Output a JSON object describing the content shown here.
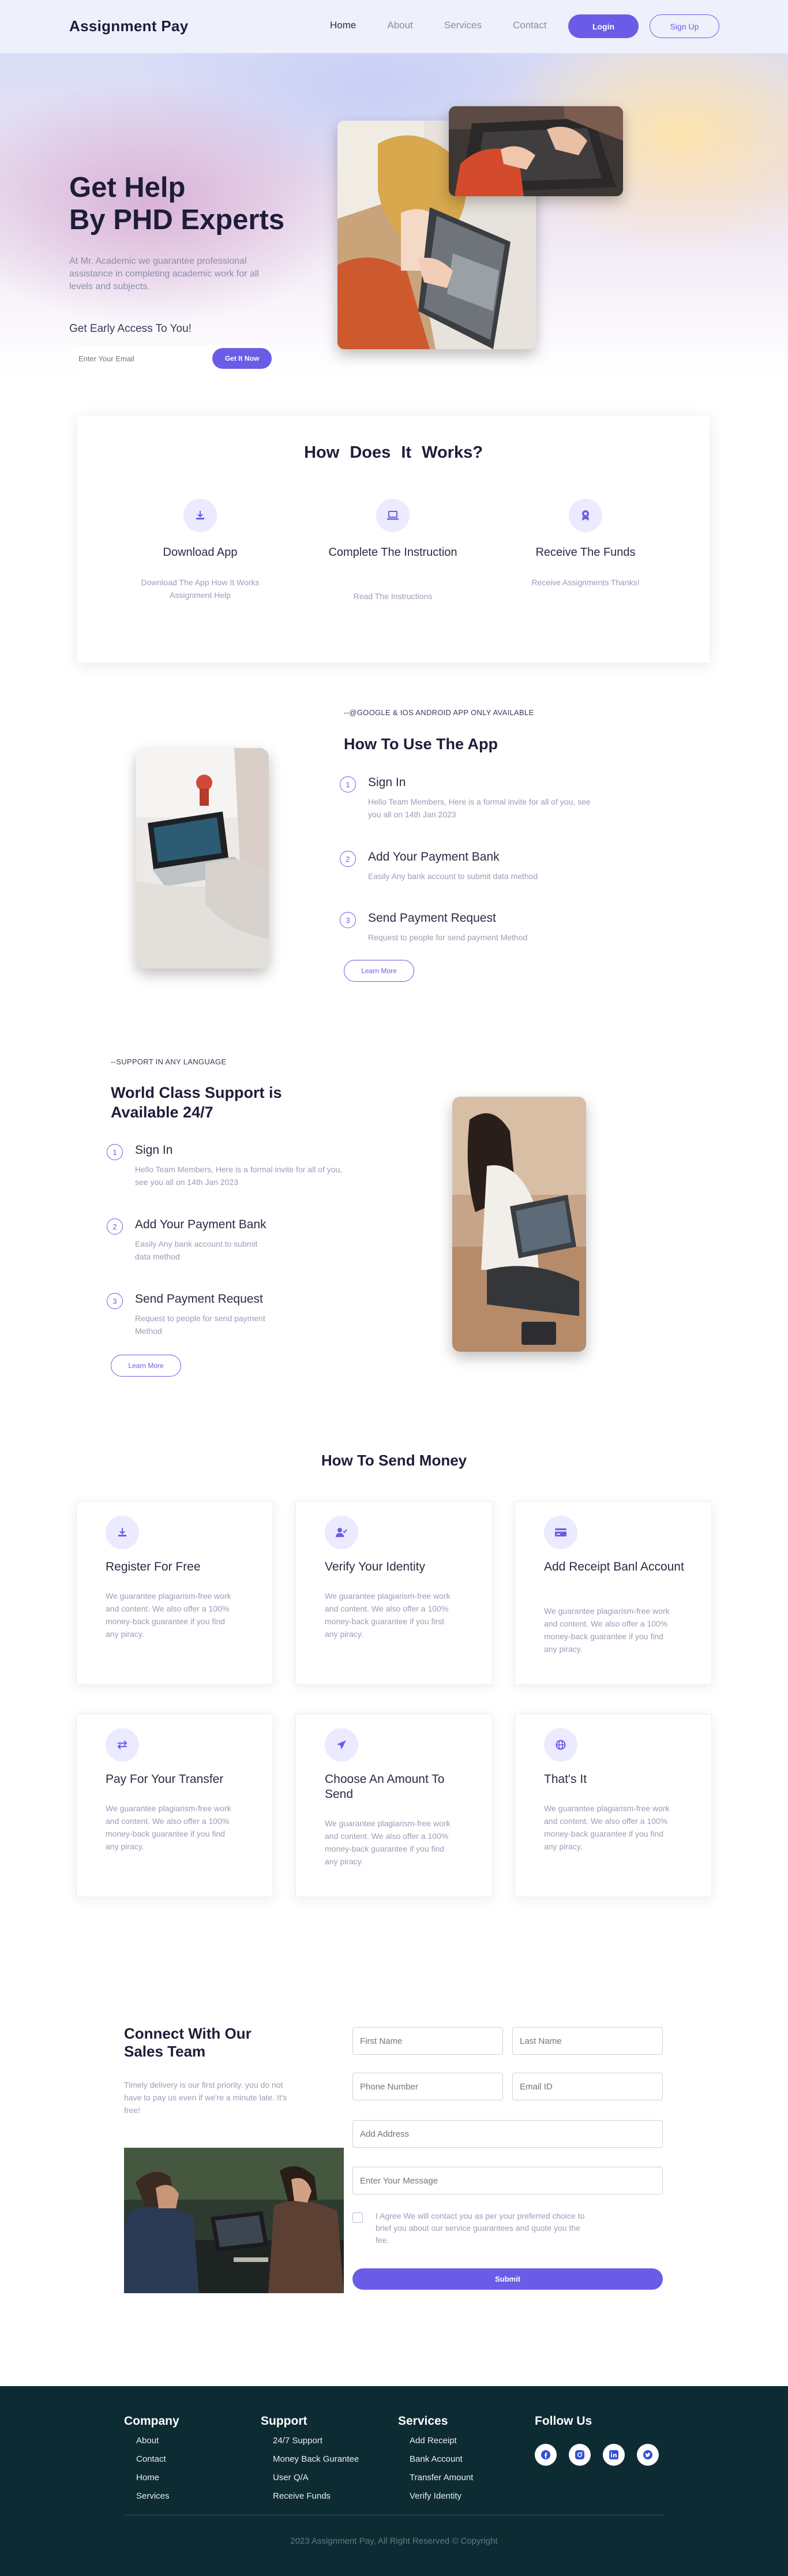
{
  "nav": {
    "logo": "Assignment Pay",
    "links": [
      "Home",
      "About",
      "Services",
      "Contact"
    ],
    "login": "Login",
    "signup": "Sign Up"
  },
  "hero": {
    "title_line1": "Get Help",
    "title_line2": "By PHD Experts",
    "desc": "At Mr. Academic we guarantee professional assistance in completing academic work for all levels and subjects.",
    "early": "Get Early Access To You!",
    "email_placeholder": "Enter Your Email",
    "cta": "Get It Now"
  },
  "how_works": {
    "title": "How Does It Works?",
    "steps": [
      {
        "name": "Download App",
        "desc": "Download The App How It Works Assignment Help",
        "icon": "download-icon"
      },
      {
        "name": "Complete The Instruction",
        "desc": "Read The Instructions",
        "icon": "laptop-icon"
      },
      {
        "name": "Receive The Funds",
        "desc": "Receive Assignments Thanks!",
        "icon": "badge-icon"
      }
    ]
  },
  "use_app": {
    "kicker": "--@GOOGLE & IOS ANDROID APP ONLY AVAILABLE",
    "title": "How To Use The App",
    "items": [
      {
        "num": "1",
        "title": "Sign In",
        "desc": "Hello Team Members, Here is a formal invite for all of you, see you all on 14th Jan 2023"
      },
      {
        "num": "2",
        "title": "Add Your Payment Bank",
        "desc": "Easily Any bank account to submit data method"
      },
      {
        "num": "3",
        "title": "Send Payment Request",
        "desc": "Request to people for send payment Method"
      }
    ],
    "button": "Learn More"
  },
  "support": {
    "kicker": "--SUPPORT IN ANY LANGUAGE",
    "title_line1": "World Class Support is",
    "title_line2": "Available 24/7",
    "items": [
      {
        "num": "1",
        "title": "Sign In",
        "desc": "Hello Team Members, Here is a formal invite for all of you, see you all on 14th Jan 2023"
      },
      {
        "num": "2",
        "title": "Add Your Payment Bank",
        "desc": "Easily Any bank account to submit data method"
      },
      {
        "num": "3",
        "title": "Send Payment Request",
        "desc": "Request to people for send payment Method"
      }
    ],
    "button": "Learn More"
  },
  "send_money": {
    "title": "How To Send Money",
    "cards": [
      {
        "title": "Register For Free",
        "icon": "download-icon",
        "desc": "We guarantee plagiarism-free work and content. We also offer a 100% money-back guarantee if you find any piracy."
      },
      {
        "title": "Verify Your Identity",
        "icon": "user-check-icon",
        "desc": "We guarantee plagiarism-free work and content. We also offer a 100% money-back guarantee if you first any piracy."
      },
      {
        "title": "Add Receipt Banl Account",
        "icon": "bank-card-icon",
        "desc": "We guarantee plagiarism-free work and content. We also offer a 100% money-back guarantee if you find any piracy."
      },
      {
        "title": "Pay For Your Transfer",
        "icon": "transfer-icon",
        "desc": "We guarantee plagiarism-free work and content. We also offer a 100% money-back guarantee if you find any piracy."
      },
      {
        "title": "Choose An Amount To Send",
        "icon": "send-icon",
        "desc": "We guarantee plagiarism-free work and content. We also offer a 100% money-back guarantee if you find any piracy."
      },
      {
        "title": "That's It",
        "icon": "globe-icon",
        "desc": "We guarantee plagiarism-free work and content. We also offer a 100% money-back guarantee if you find any piracy."
      }
    ]
  },
  "contact": {
    "title_line1": "Connect With Our",
    "title_line2": "Sales Team",
    "desc": "Timely delivery is our first priority. you do not have to pay us even if we're a minute late. It's free!",
    "first_name": "First Name",
    "last_name": "Last Name",
    "phone": "Phone Number",
    "email": "Email ID",
    "address": "Add Address",
    "message": "Enter Your Message",
    "consent": "I Agree We will contact you as per your preferred choice to brief you about our service guarantees and quote you the fee.",
    "submit": "Submit"
  },
  "footer": {
    "company": {
      "title": "Company",
      "links": [
        "About",
        "Contact",
        "Home",
        "Services"
      ]
    },
    "support": {
      "title": "Support",
      "links": [
        "24/7 Support",
        "Money Back Gurantee",
        "User Q/A",
        "Receive Funds"
      ]
    },
    "services": {
      "title": "Services",
      "links": [
        "Add Receipt",
        "Bank Account",
        "Transfer Amount",
        "Verify Identity"
      ]
    },
    "follow": {
      "title": "Follow Us",
      "icons": [
        "facebook-icon",
        "instagram-icon",
        "linkedin-icon",
        "twitter-icon"
      ]
    },
    "copyright": "2023 Assignment Pay, All Right Reserved © Copyright"
  },
  "colors": {
    "accent": "#6b5ce7",
    "footer_bg": "#0d2b33",
    "nav_bg": "#eef0fb"
  }
}
